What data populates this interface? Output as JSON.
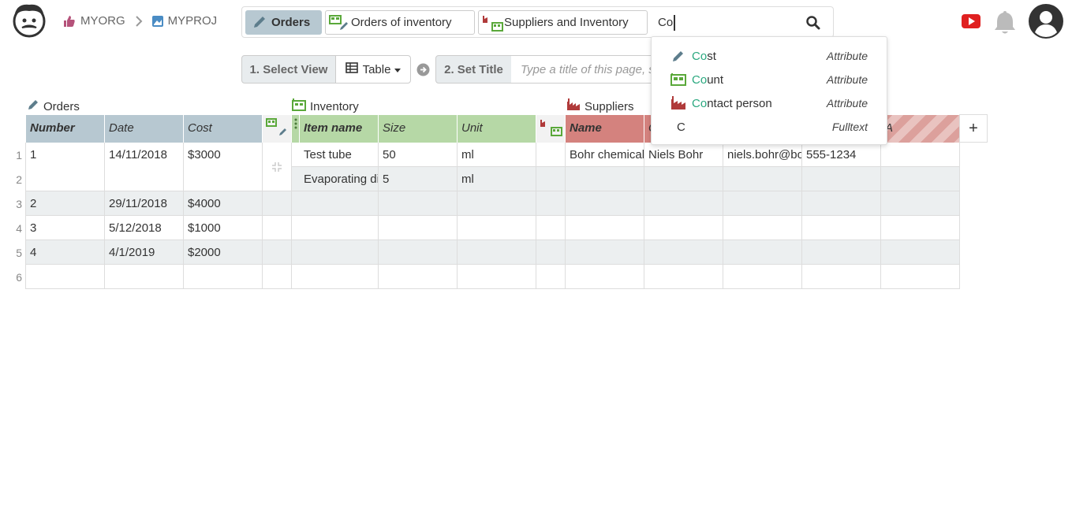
{
  "breadcrumb": {
    "org": "MYORG",
    "project": "MYPROJ"
  },
  "search": {
    "chips": [
      {
        "label": "Orders",
        "icon": "pencil-icon",
        "active": true
      },
      {
        "label": "Orders of inventory",
        "icon": "inventory-pencil-icon",
        "active": false
      },
      {
        "label": "Suppliers and Inventory",
        "icon": "supplier-inventory-icon",
        "active": false
      }
    ],
    "query": "Co"
  },
  "suggestions": [
    {
      "prefix": "Co",
      "rest": "st",
      "type": "Attribute",
      "icon": "pencil-icon"
    },
    {
      "prefix": "Co",
      "rest": "unt",
      "type": "Attribute",
      "icon": "inventory-icon"
    },
    {
      "prefix": "Co",
      "rest": "ntact person",
      "type": "Attribute",
      "icon": "factory-icon"
    },
    {
      "prefix": "",
      "rest": "C",
      "type": "Fulltext",
      "icon": ""
    }
  ],
  "toolbar": {
    "step1": "1. Select View",
    "view": "Table",
    "step2": "2. Set Title",
    "title_placeholder": "Type a title of this page, save"
  },
  "groups": {
    "orders": "Orders",
    "inventory": "Inventory",
    "suppliers": "Suppliers"
  },
  "columns": {
    "orders": [
      "Number",
      "Date",
      "Cost"
    ],
    "inventory": [
      "Item name",
      "Size",
      "Unit"
    ],
    "suppliers": [
      "Name",
      "C",
      "",
      "",
      "A"
    ]
  },
  "rows": [
    {
      "n": "1",
      "number": "1",
      "date": "14/11/2018",
      "cost": "$3000",
      "item": "Test tube",
      "size": "50",
      "unit": "ml",
      "sname": "Bohr chemicals",
      "contact": "Niels Bohr",
      "email": "niels.bohr@bohr.com",
      "phone": "555-1234"
    },
    {
      "n": "2",
      "number": "",
      "date": "",
      "cost": "",
      "item": "Evaporating dish",
      "size": "5",
      "unit": "ml",
      "sname": "",
      "contact": "",
      "email": "",
      "phone": ""
    },
    {
      "n": "3",
      "number": "2",
      "date": "29/11/2018",
      "cost": "$4000",
      "item": "",
      "size": "",
      "unit": "",
      "sname": "",
      "contact": "",
      "email": "",
      "phone": ""
    },
    {
      "n": "4",
      "number": "3",
      "date": "5/12/2018",
      "cost": "$1000",
      "item": "",
      "size": "",
      "unit": "",
      "sname": "",
      "contact": "",
      "email": "",
      "phone": ""
    },
    {
      "n": "5",
      "number": "4",
      "date": "4/1/2019",
      "cost": "$2000",
      "item": "",
      "size": "",
      "unit": "",
      "sname": "",
      "contact": "",
      "email": "",
      "phone": ""
    },
    {
      "n": "6",
      "number": "",
      "date": "",
      "cost": "",
      "item": "",
      "size": "",
      "unit": "",
      "sname": "",
      "contact": "",
      "email": "",
      "phone": ""
    }
  ],
  "add_column_label": "+",
  "colors": {
    "orders": "#b7c8d1",
    "inventory": "#b6d8a6",
    "suppliers": "#d4827e",
    "highlight": "#2aa87f",
    "youtube": "#e02020"
  }
}
